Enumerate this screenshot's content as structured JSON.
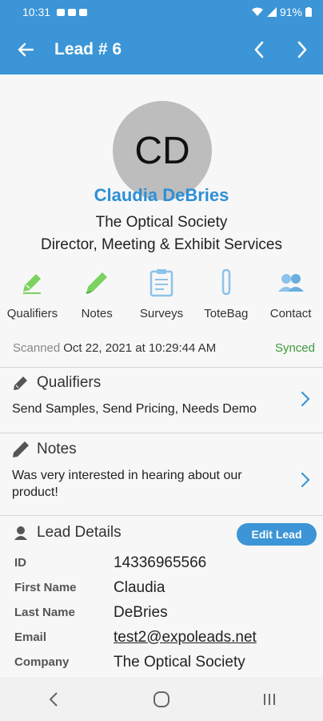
{
  "status_bar": {
    "time": "10:31",
    "battery": "91%"
  },
  "app_bar": {
    "title": "Lead # 6"
  },
  "lead": {
    "initials": "CD",
    "name": "Claudia DeBries",
    "company": "The Optical Society",
    "job_title": "Director, Meeting & Exhibit Services"
  },
  "actions": [
    {
      "label": "Qualifiers",
      "icon": "qualifiers-icon",
      "color": "#7bd25f"
    },
    {
      "label": "Notes",
      "icon": "notes-pencil-icon",
      "color": "#7bd25f"
    },
    {
      "label": "Surveys",
      "icon": "clipboard-icon",
      "color": "#8cc3ea"
    },
    {
      "label": "ToteBag",
      "icon": "paperclip-icon",
      "color": "#8cc3ea"
    },
    {
      "label": "Contact",
      "icon": "contact-people-icon",
      "color": "#8cc3ea"
    }
  ],
  "scan": {
    "label": "Scanned",
    "value": "Oct 22, 2021 at 10:29:44 AM",
    "status": "Synced"
  },
  "qualifiers": {
    "title": "Qualifiers",
    "text": "Send Samples, Send Pricing, Needs Demo"
  },
  "notes": {
    "title": "Notes",
    "text": "Was very interested in hearing about our product!"
  },
  "lead_details": {
    "title": "Lead Details",
    "edit_label": "Edit Lead",
    "rows": [
      {
        "key": "ID",
        "value": "14336965566"
      },
      {
        "key": "First Name",
        "value": "Claudia"
      },
      {
        "key": "Last Name",
        "value": "DeBries"
      },
      {
        "key": "Email",
        "value": "test2@expoleads.net"
      },
      {
        "key": "Company",
        "value": "The Optical Society"
      }
    ]
  },
  "colors": {
    "primary": "#3b95d6",
    "accent_name": "#2d8fd6",
    "synced": "#3b9b3b"
  }
}
